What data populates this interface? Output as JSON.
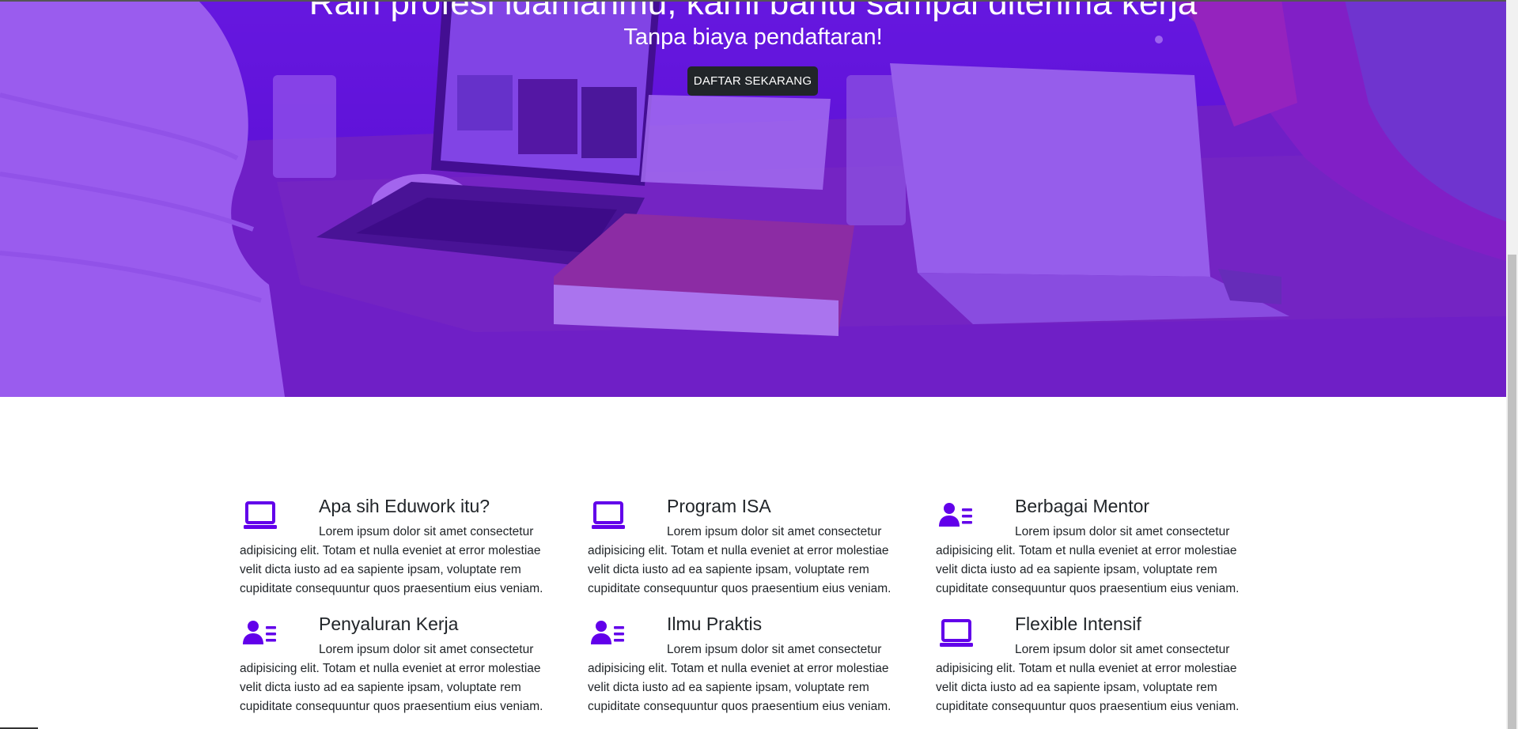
{
  "hero": {
    "title": "Raih profesi idamanmu, kami bantu sampai diterima kerja",
    "subtitle": "Tanpa biaya pendaftaran!",
    "cta_label": "DAFTAR SEKARANG",
    "overlay_color": "#6200ea"
  },
  "features": [
    {
      "icon": "laptop-icon",
      "title": "Apa sih Eduwork itu?",
      "text": "Lorem ipsum dolor sit amet consectetur adipisicing elit. Totam et nulla eveniet at error molestiae velit dicta iusto ad ea sapiente ipsam, voluptate rem cupiditate consequuntur quos praesentium eius veniam."
    },
    {
      "icon": "laptop-icon",
      "title": "Program ISA",
      "text": "Lorem ipsum dolor sit amet consectetur adipisicing elit. Totam et nulla eveniet at error molestiae velit dicta iusto ad ea sapiente ipsam, voluptate rem cupiditate consequuntur quos praesentium eius veniam."
    },
    {
      "icon": "user-list-icon",
      "title": "Berbagai Mentor",
      "text": "Lorem ipsum dolor sit amet consectetur adipisicing elit. Totam et nulla eveniet at error molestiae velit dicta iusto ad ea sapiente ipsam, voluptate rem cupiditate consequuntur quos praesentium eius veniam."
    },
    {
      "icon": "user-list-icon",
      "title": "Penyaluran Kerja",
      "text": "Lorem ipsum dolor sit amet consectetur adipisicing elit. Totam et nulla eveniet at error molestiae velit dicta iusto ad ea sapiente ipsam, voluptate rem cupiditate consequuntur quos praesentium eius veniam."
    },
    {
      "icon": "user-list-icon",
      "title": "Ilmu Praktis",
      "text": "Lorem ipsum dolor sit amet consectetur adipisicing elit. Totam et nulla eveniet at error molestiae velit dicta iusto ad ea sapiente ipsam, voluptate rem cupiditate consequuntur quos praesentium eius veniam."
    },
    {
      "icon": "laptop-icon",
      "title": "Flexible Intensif",
      "text": "Lorem ipsum dolor sit amet consectetur adipisicing elit. Totam et nulla eveniet at error molestiae velit dicta iusto ad ea sapiente ipsam, voluptate rem cupiditate consequuntur quos praesentium eius veniam."
    }
  ],
  "colors": {
    "accent": "#6200ea",
    "button_dark": "#212529",
    "text": "#212529"
  }
}
